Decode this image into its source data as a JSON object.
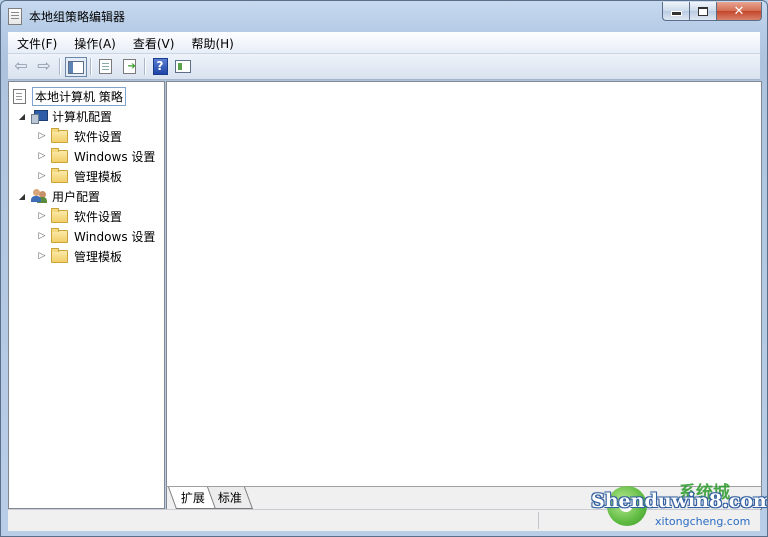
{
  "window": {
    "title": "本地组策略编辑器"
  },
  "menu": [
    "文件(F)",
    "操作(A)",
    "查看(V)",
    "帮助(H)"
  ],
  "toolbar": {
    "back_icon": "back-arrow-icon",
    "forward_icon": "forward-arrow-icon",
    "show_tree_icon": "console-tree-icon",
    "properties_icon": "properties-icon",
    "export_icon": "export-list-icon",
    "help_icon": "help-icon",
    "action_pane_icon": "action-pane-icon"
  },
  "tree": {
    "root": "本地计算机 策略",
    "computer_config": "计算机配置",
    "computer_children": [
      "软件设置",
      "Windows 设置",
      "管理模板"
    ],
    "user_config": "用户配置",
    "user_children": [
      "软件设置",
      "Windows 设置",
      "管理模板"
    ]
  },
  "tabs": [
    "扩展",
    "标准"
  ],
  "watermark": {
    "brand": "Shenduwin8.com",
    "cn": "系统城",
    "sub": "xitongcheng.com"
  },
  "colors": {
    "accent": "#3e6db5",
    "close_button": "#c4462a",
    "folder": "#f1cf6a"
  }
}
